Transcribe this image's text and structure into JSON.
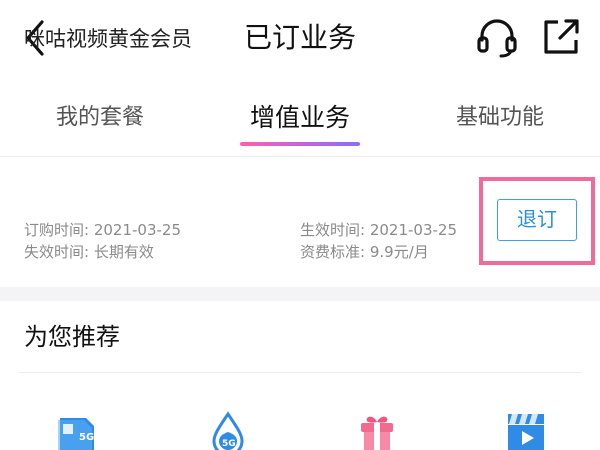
{
  "header": {
    "title": "已订业务"
  },
  "tabs": [
    {
      "label": "我的套餐",
      "active": false
    },
    {
      "label": "增值业务",
      "active": true
    },
    {
      "label": "基础功能",
      "active": false
    }
  ],
  "subscription": {
    "name": "咪咕视频黄金会员",
    "order_time_label": "订购时间:",
    "order_time_value": "2021-03-25",
    "effective_time_label": "生效时间:",
    "effective_time_value": "2021-03-25",
    "expire_time_label": "失效时间:",
    "expire_time_value": "长期有效",
    "fee_label": "资费标准:",
    "fee_value": "9.9元/月",
    "unsubscribe_label": "退订"
  },
  "recommend": {
    "title": "为您推荐",
    "icons": [
      {
        "name": "5g-sim-card-icon",
        "text": "5G"
      },
      {
        "name": "5g-water-drop-icon",
        "text": "5G"
      },
      {
        "name": "gift-box-icon"
      },
      {
        "name": "video-clapper-icon"
      }
    ]
  },
  "colors": {
    "accent_blue": "#2b8fe0",
    "highlight_pink": "#f06b9a",
    "tab_gradient_start": "#ff5fae",
    "tab_gradient_end": "#8a6cff"
  }
}
